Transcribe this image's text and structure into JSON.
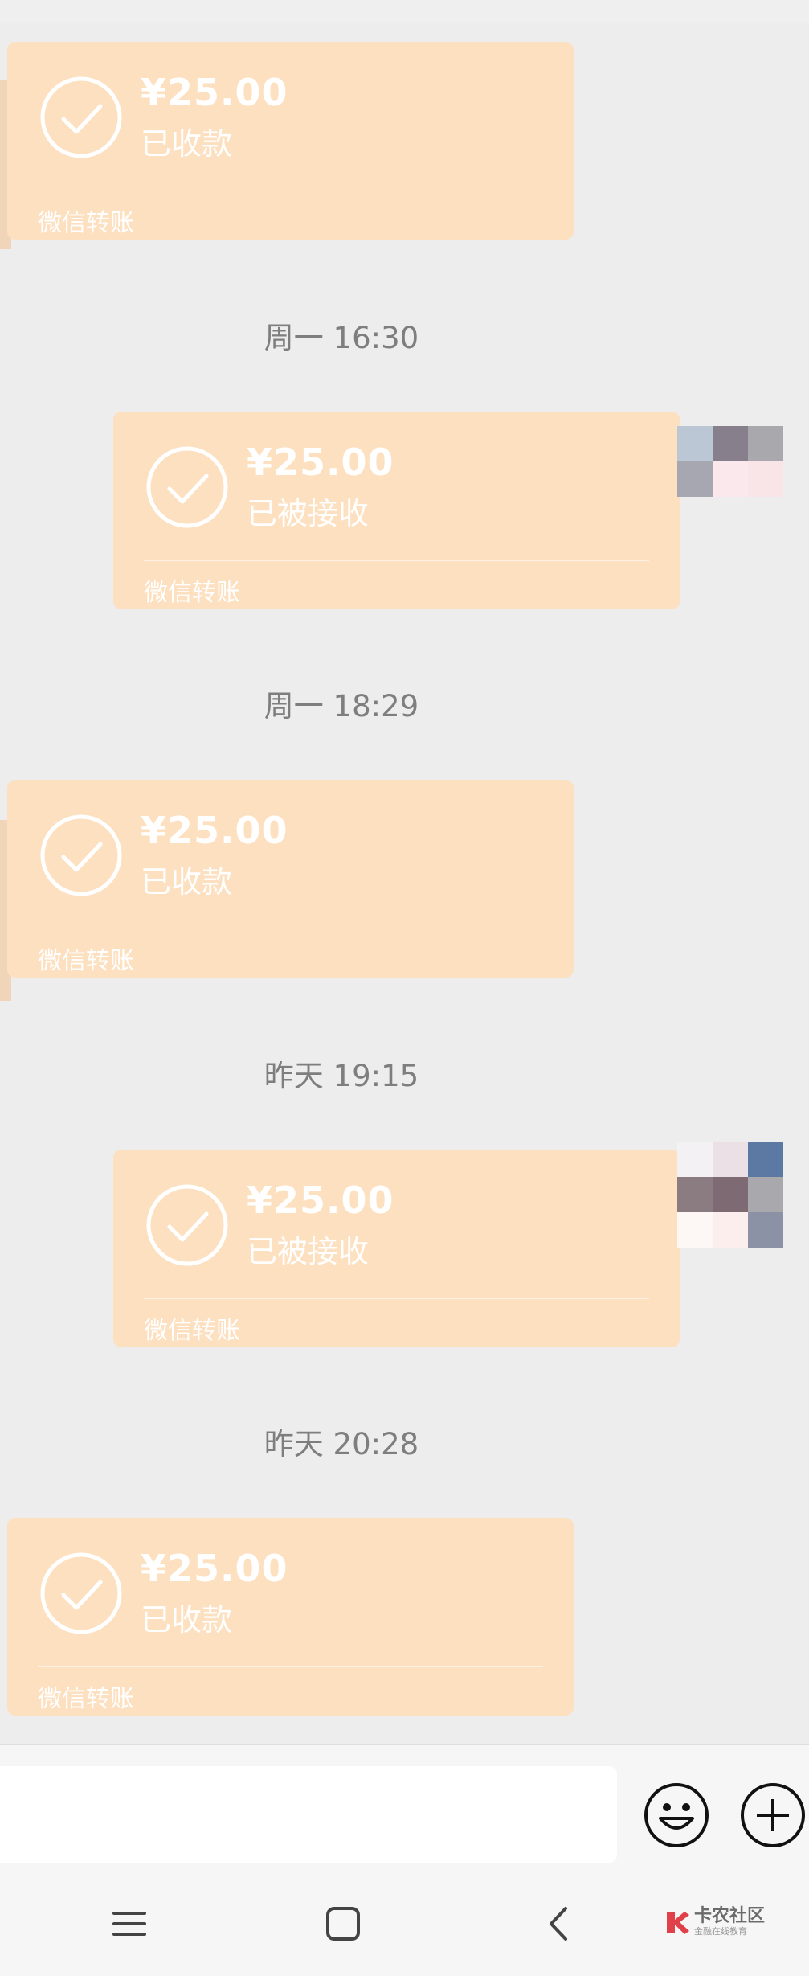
{
  "messages": [
    {
      "amount": "¥25.00",
      "status": "已收款",
      "footer": "微信转账"
    },
    {
      "timestamp": "周一 16:30",
      "amount": "¥25.00",
      "status": "已被接收",
      "footer": "微信转账"
    },
    {
      "timestamp": "周一 18:29",
      "amount": "¥25.00",
      "status": "已收款",
      "footer": "微信转账"
    },
    {
      "timestamp": "昨天 19:15",
      "amount": "¥25.00",
      "status": "已被接收",
      "footer": "微信转账"
    },
    {
      "timestamp": "昨天 20:28",
      "amount": "¥25.00",
      "status": "已收款",
      "footer": "微信转账"
    }
  ],
  "input_bar": {
    "icons": [
      "emoji-icon",
      "plus-icon"
    ]
  },
  "navbar": {
    "icons": [
      "menu-icon",
      "home-icon",
      "back-icon"
    ]
  },
  "watermark": {
    "name": "卡农社区",
    "tagline": "金融在线教育"
  },
  "colors": {
    "bubble": "#fde0c0",
    "background": "#ededed",
    "timestamp": "#7e7e7e"
  }
}
